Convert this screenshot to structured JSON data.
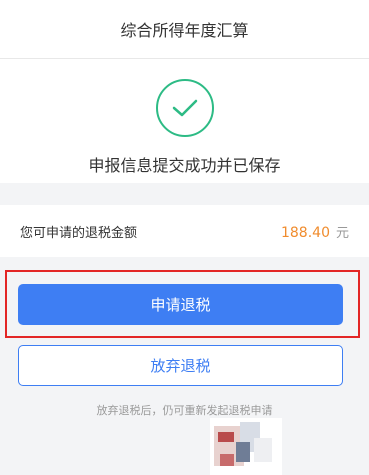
{
  "header": {
    "title": "综合所得年度汇算"
  },
  "success": {
    "message": "申报信息提交成功并已保存",
    "icon": "check-circle-icon"
  },
  "refund": {
    "label": "您可申请的退税金额",
    "amount": "188.40",
    "unit": "元"
  },
  "actions": {
    "apply_label": "申请退税",
    "giveup_label": "放弃退税"
  },
  "note": "放弃退税后，仍可重新发起退税申请",
  "colors": {
    "primary": "#3e7ef3",
    "success": "#2dbb85",
    "amount": "#f08c2e",
    "highlight": "#e32626"
  }
}
